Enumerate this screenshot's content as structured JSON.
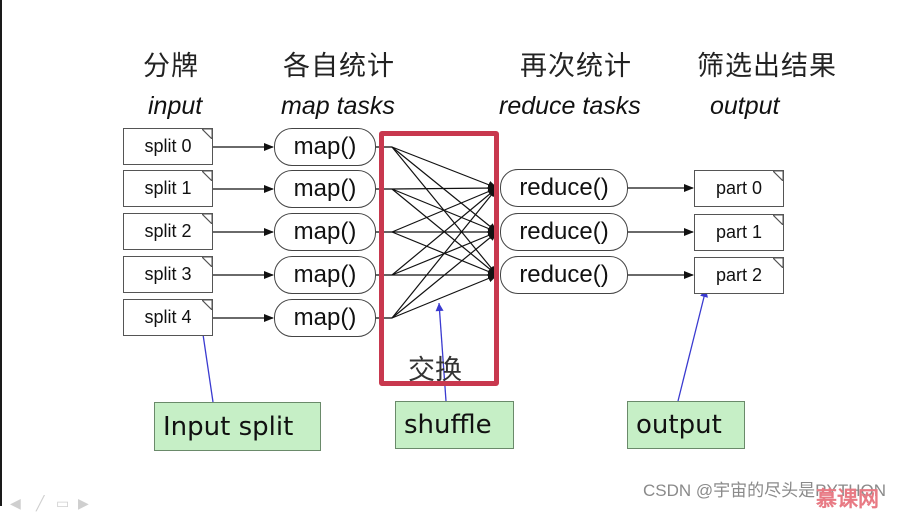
{
  "headers": {
    "input": {
      "cn": "分牌",
      "en": "input"
    },
    "map": {
      "cn": "各自统计",
      "en": "map tasks"
    },
    "reduce": {
      "cn": "再次统计",
      "en": "reduce tasks"
    },
    "output": {
      "cn": "筛选出结果",
      "en": "output"
    }
  },
  "splits": [
    "split 0",
    "split 1",
    "split 2",
    "split 3",
    "split 4"
  ],
  "maps": [
    "map()",
    "map()",
    "map()",
    "map()",
    "map()"
  ],
  "reduces": [
    "reduce()",
    "reduce()",
    "reduce()"
  ],
  "parts": [
    "part 0",
    "part 1",
    "part 2"
  ],
  "shuffle": {
    "cn_label": "交换"
  },
  "callouts": {
    "input_split": "Input split",
    "shuffle": "shuffle",
    "output": "output"
  },
  "colors": {
    "shuffle_frame": "#c8384e",
    "callout_fill": "#c6efc6",
    "callout_arrow": "#3a3ad0"
  },
  "watermark": {
    "text": "CSDN @宇宙的尽头是PYTHON",
    "logo": "慕课网"
  },
  "player_controls": [
    "prev-icon",
    "pen-icon",
    "screen-icon",
    "next-icon"
  ]
}
